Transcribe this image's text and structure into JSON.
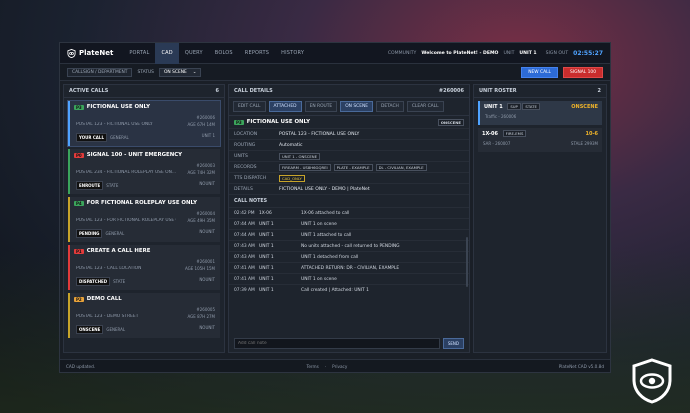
{
  "nav": {
    "brand": "PlateNet",
    "links": [
      "PORTAL",
      "CAD",
      "QUERY",
      "BOLOS",
      "REPORTS",
      "HISTORY"
    ],
    "community_label": "COMMUNITY",
    "welcome": "Welcome to PlateNet! - DEMO",
    "unit_label": "UNIT",
    "unit": "UNIT 1",
    "signout": "SIGN OUT",
    "clock": "02:55:27"
  },
  "sub": {
    "callsign_label": "CALLSIGN / DEPARTMENT",
    "status_label": "STATUS",
    "status_value": "ON SCENE",
    "new_call": "NEW CALL",
    "signal": "SIGNAL 100"
  },
  "active": {
    "title": "ACTIVE CALLS",
    "count": "6",
    "calls": [
      {
        "pri": "P3",
        "title": "FICTIONAL USE ONLY",
        "num": "#260006",
        "loc": "POSTAL 123 - FICTIONAL USE ONLY",
        "age": "AGE 67H 14M",
        "status": "YOUR CALL",
        "dept": "GENERAL",
        "units": "UNIT 1",
        "color": "#4fa3ff",
        "pc": "#3ba55c"
      },
      {
        "pri": "P0",
        "title": "SIGNAL 100 - UNIT EMERGENCY",
        "num": "#260003",
        "loc": "POSTAL 234 - FICTIONAL ROLEPLAY USE ON...",
        "age": "AGE 74H 32M",
        "status": "ENROUTE",
        "dept": "STATE",
        "units": "NOUNIT",
        "color": "#3ba55c",
        "pc": "#e23b3b"
      },
      {
        "pri": "P4",
        "title": "FOR FICTIONAL ROLEPLAY USE ONLY",
        "num": "#260004",
        "loc": "POSTAL 123 - FOR FICTIONAL ROLEPLAY USE ONL...",
        "age": "AGE 49H 35M",
        "status": "PENDING",
        "dept": "GENERAL",
        "units": "NOUNIT",
        "color": "#c7a42a",
        "pc": "#3ba55c"
      },
      {
        "pri": "P1",
        "title": "CREATE A CALL HERE",
        "num": "#260001",
        "loc": "POSTAL 123 - CALL LOCATION",
        "age": "AGE 105H 15M",
        "status": "DISPATCHED",
        "dept": "STATE",
        "units": "NOUNIT",
        "color": "#e23b3b",
        "pc": "#e23b3b"
      },
      {
        "pri": "P2",
        "title": "DEMO CALL",
        "num": "#260005",
        "loc": "POSTAL 123 - DEMO STREET",
        "age": "AGE 87H 27M",
        "status": "ONSCENE",
        "dept": "GENERAL",
        "units": "NOUNIT",
        "color": "#c7a42a",
        "pc": "#e8a23a"
      }
    ]
  },
  "details": {
    "title": "CALL DETAILS",
    "num": "#260006",
    "tabs": [
      "EDIT CALL",
      "ATTACHED",
      "EN ROUTE",
      "ON SCENE",
      "DETACH",
      "CLEAR CALL"
    ],
    "pri": "P3",
    "call_title": "FICTIONAL USE ONLY",
    "call_status": "ONSCENE",
    "location_k": "LOCATION",
    "location": "POSTAL 123 - FICTIONAL USE ONLY",
    "routing_k": "ROUTING",
    "routing": "Automatic",
    "units_k": "UNITS",
    "units": "UNIT 1 - ONSCENE",
    "records_k": "RECORDS",
    "records": [
      "FIREARM - US8H6GQREI",
      "PLATE - EXAMPLE",
      "DL - CIVILIAN, EXAMPLE"
    ],
    "tts_k": "TTS DISPATCH",
    "tts": "CAD_ONLY",
    "details_k": "DETAILS",
    "details": "FICTIONAL USE ONLY - DEMO | PlateNet",
    "notes_title": "CALL NOTES",
    "notes": [
      {
        "t": "02:42 PM",
        "u": "1X-06",
        "m": "1X-06 attached to call"
      },
      {
        "t": "07:44 AM",
        "u": "UNIT 1",
        "m": "UNIT 1 on scene"
      },
      {
        "t": "07:44 AM",
        "u": "UNIT 1",
        "m": "UNIT 1 attached to call"
      },
      {
        "t": "07:43 AM",
        "u": "UNIT 1",
        "m": "No units attached - call returned to PENDING"
      },
      {
        "t": "07:43 AM",
        "u": "UNIT 1",
        "m": "UNIT 1 detached from call"
      },
      {
        "t": "07:41 AM",
        "u": "UNIT 1",
        "m": "ATTACHED RETURN: DR - CIVILIAN, EXAMPLE"
      },
      {
        "t": "07:41 AM",
        "u": "UNIT 1",
        "m": "UNIT 1 on scene"
      },
      {
        "t": "07:39 AM",
        "u": "UNIT 1",
        "m": "Call created | Attached: UNIT 1"
      }
    ],
    "note_placeholder": "Add call note",
    "send": "SEND"
  },
  "roster": {
    "title": "UNIT ROSTER",
    "count": "2",
    "units": [
      {
        "name": "UNIT 1",
        "tag1": "SUP",
        "tag2": "STATE",
        "status": "ONSCENE",
        "status_color": "#f0b429",
        "line": "Traffic - 260006",
        "right": ""
      },
      {
        "name": "1X-06",
        "tag1": "FIRE-EMS",
        "tag2": "",
        "status": "10-6",
        "status_color": "#f0b429",
        "line": "SAR - 260007",
        "right": "STALE 2993M"
      }
    ]
  },
  "footer": {
    "left": "CAD updated.",
    "terms": "Terms",
    "privacy": "Privacy",
    "version": "PlateNet CAD v5.0.8d"
  }
}
